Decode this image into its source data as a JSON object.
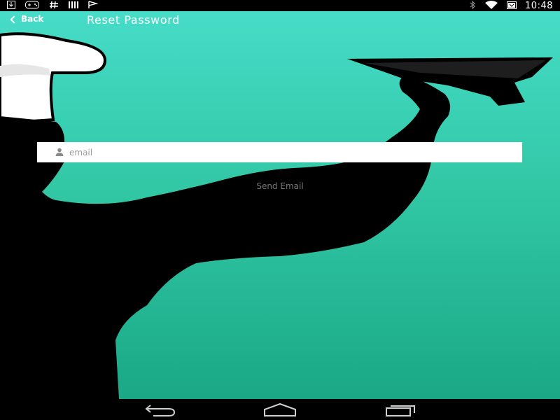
{
  "status_bar": {
    "left_icons": [
      "download-icon",
      "gamepad-icon",
      "hash-icon",
      "signal-bars-icon",
      "check-flag-icon"
    ],
    "right_icons": [
      "bluetooth-icon",
      "wifi-icon",
      "battery-icon"
    ],
    "time": "10:48"
  },
  "action_bar": {
    "back_label": "Back",
    "title": "Reset Password"
  },
  "form": {
    "email_placeholder": "email",
    "email_value": "",
    "send_label": "Send Email"
  },
  "nav_bar": {
    "buttons": [
      "back-nav-icon",
      "home-nav-icon",
      "recents-nav-icon"
    ]
  },
  "colors": {
    "gradient_top": "#46dcc8",
    "gradient_bottom": "#1aa886",
    "silhouette": "#000000",
    "hat": "#ffffff"
  }
}
